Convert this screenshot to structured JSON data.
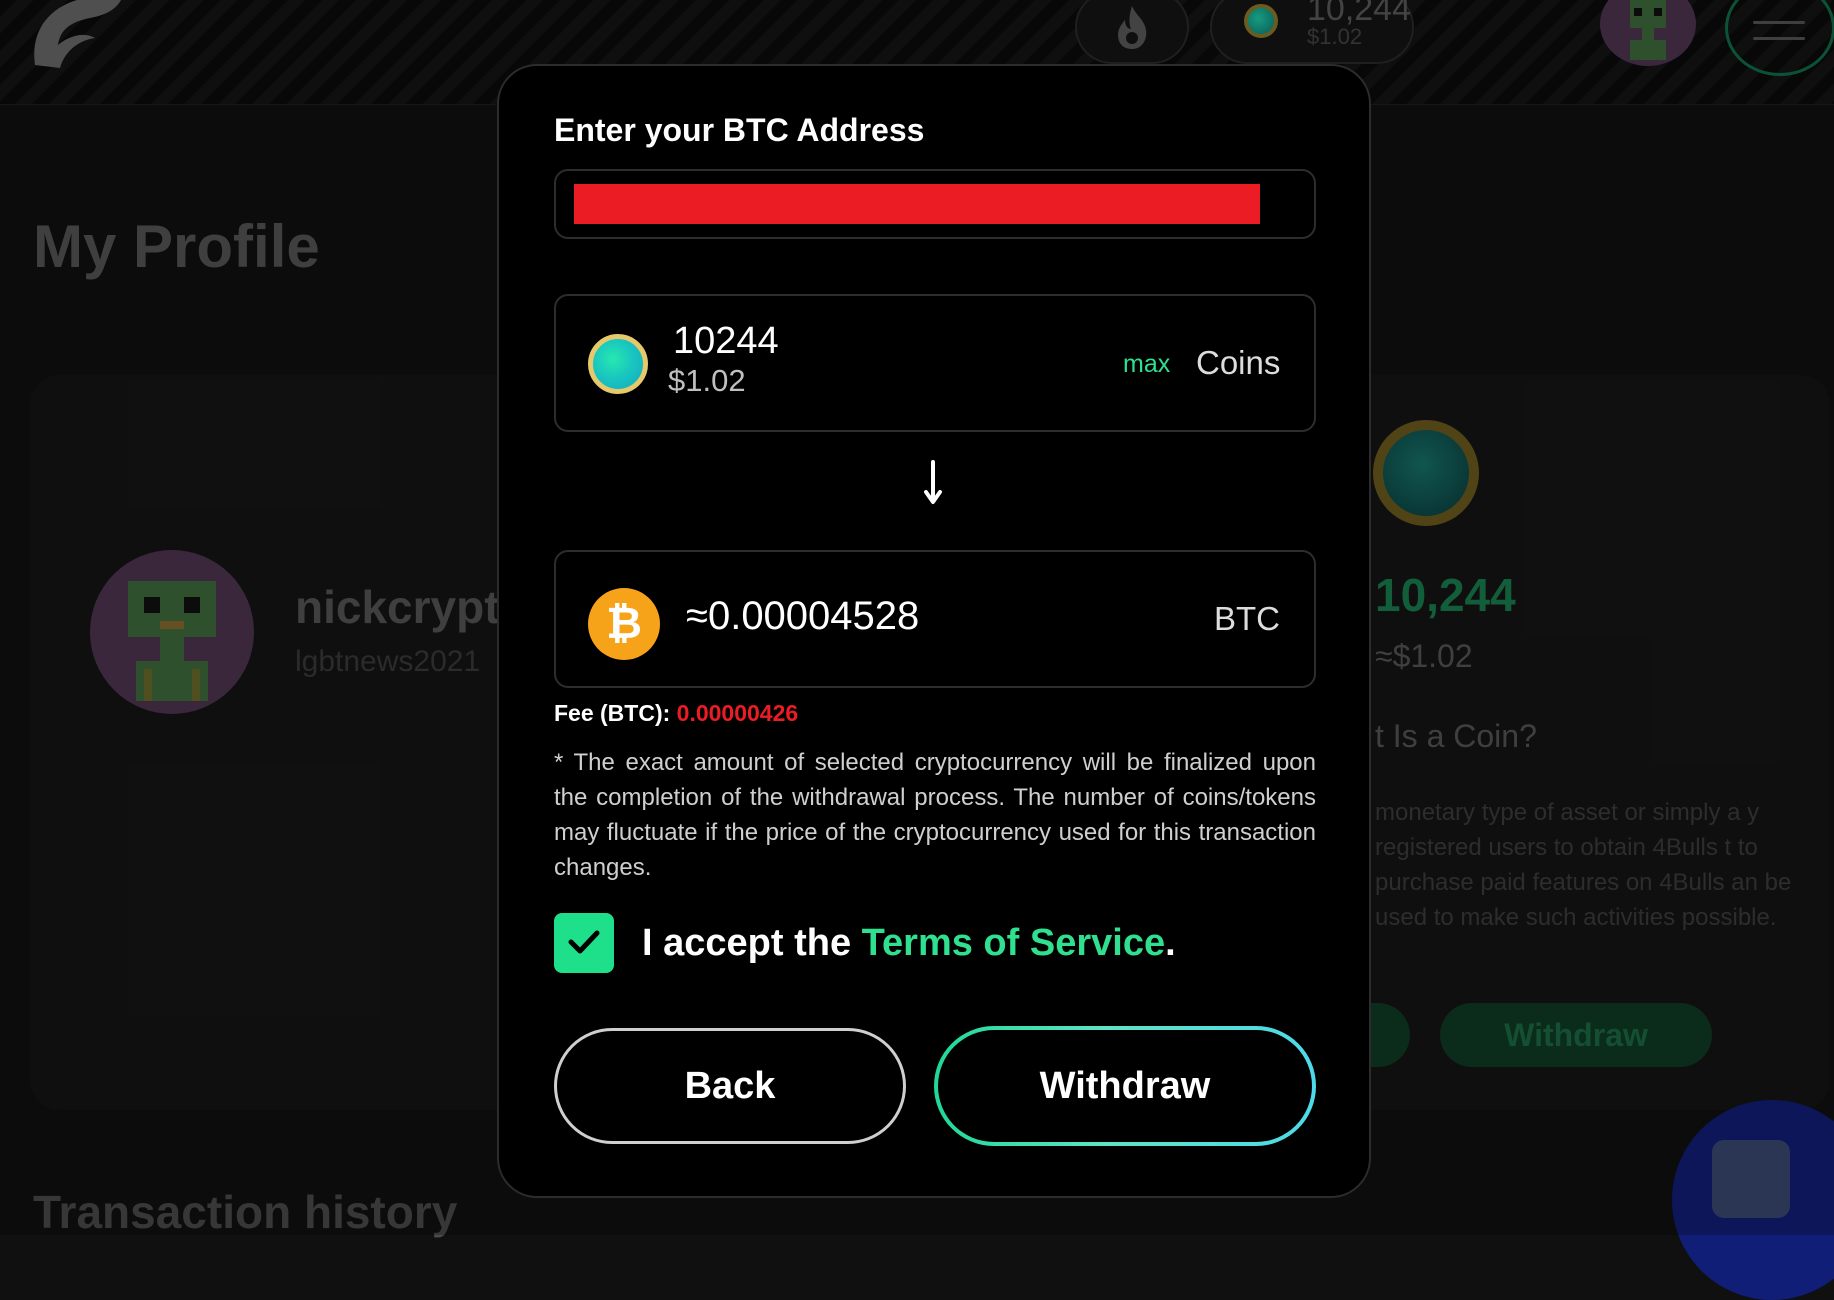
{
  "header": {
    "balance_value": "10,244",
    "balance_usd": "$1.02"
  },
  "page": {
    "title": "My Profile",
    "username": "nickcrypt",
    "email": "lgbtnews2021",
    "coin_balance": "10,244",
    "coin_balance_usd": "≈$1.02",
    "what_is_coin_title": "t Is a Coin?",
    "what_is_coin_text": "monetary type of asset or simply a y registered users to obtain 4Bulls t to purchase paid features on 4Bulls an be used to make such activities possible.",
    "withdraw_label": "Withdraw",
    "transaction_history": "Transaction history"
  },
  "modal": {
    "address_label": "Enter your BTC Address",
    "address_value": "",
    "coins_amount": "10244",
    "coins_usd": "$1.02",
    "max_label": "max",
    "coins_unit": "Coins",
    "btc_amount": "≈0.00004528",
    "btc_unit": "BTC",
    "fee_label": "Fee (BTC):",
    "fee_value": "0.00000426",
    "note": "* The exact amount of selected cryptocurrency will be finalized upon the completion of the withdrawal process. The number of coins/tokens may fluctuate if the price of the cryptocurrency used for this transaction changes.",
    "accept_prefix": "I accept the ",
    "tos_link": "Terms of Service",
    "accept_suffix": ".",
    "terms_checked": true,
    "back_label": "Back",
    "withdraw_label": "Withdraw"
  },
  "colors": {
    "accent_green": "#2fe08f",
    "fee_red": "#ec1c24",
    "btc_orange": "#f7a31a"
  },
  "icons": [
    "logo-icon",
    "flame-icon",
    "coin-icon",
    "avatar",
    "menu-icon",
    "down-arrow-icon",
    "bitcoin-icon",
    "check-icon",
    "chat-icon"
  ]
}
